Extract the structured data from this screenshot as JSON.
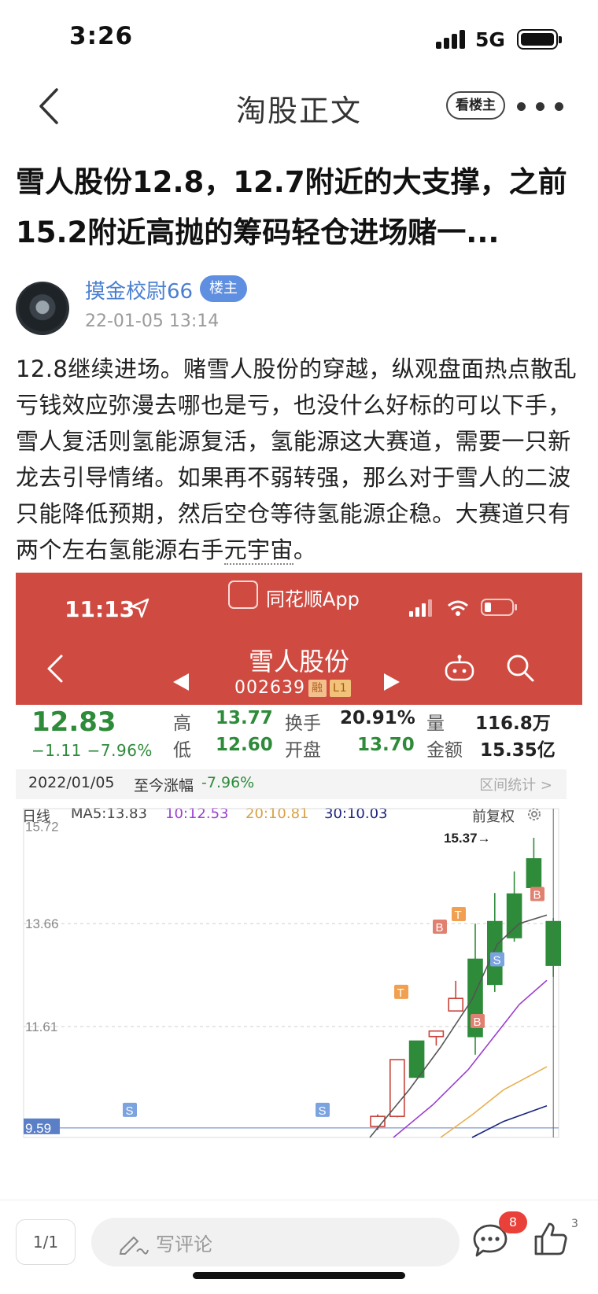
{
  "status_bar": {
    "time": "3:26",
    "network": "5G"
  },
  "nav": {
    "title": "淘股正文",
    "owner_btn": "看楼主"
  },
  "post": {
    "title": "雪人股份12.8，12.7附近的大支撑，之前15.2附近高抛的筹码轻仓进场赌一...",
    "author": "摸金校尉66",
    "owner_badge": "楼主",
    "time": "22-01-05 13:14",
    "body_main": "12.8继续进场。赌雪人股份的穿越，纵观盘面热点散乱亏钱效应弥漫去哪也是亏，也没什么好标的可以下手，雪人复活则氢能源复活，氢能源这大赛道，需要一只新龙去引导情绪。如果再不弱转强，那么对于雪人的二波只能降低预期，然后空仓等待氢能源企稳。大赛道只有两个左右氢能源右手",
    "body_link": "元宇宙",
    "body_end": "。"
  },
  "screenshot": {
    "time": "11:13",
    "app_name": "同花顺App",
    "stock_name": "雪人股份",
    "stock_code": "002639",
    "tag_rong": "融",
    "tag_l1": "L1",
    "price": "12.83",
    "change": "−1.11  −7.96%",
    "quote": {
      "high_label": "高",
      "high": "13.77",
      "low_label": "低",
      "low": "12.60",
      "turnover_label": "换手",
      "turnover": "20.91%",
      "open_label": "开盘",
      "open": "13.70",
      "volume_label": "量",
      "volume": "116.8万",
      "amount_label": "金额",
      "amount": "15.35亿"
    },
    "range": {
      "date": "2022/01/05",
      "label": "至今涨幅",
      "value": "-7.96%",
      "link": "区间统计 >"
    },
    "ma": {
      "period": "日线",
      "ma5": "MA5:13.83",
      "ma10": "10:12.53",
      "ma20": "20:10.81",
      "ma30": "30:10.03",
      "adjust": "前复权"
    },
    "colors": {
      "header": "#cf4b42",
      "down": "#2e8b3a",
      "up": "#c8423a",
      "ma5": "#555555",
      "ma10": "#9b3fd1",
      "ma20": "#e6b050",
      "ma30": "#1a237e"
    }
  },
  "chart_data": {
    "type": "candlestick",
    "ytick_labels": [
      "15.72",
      "13.66",
      "11.61",
      "9.59"
    ],
    "ylim": [
      9.4,
      15.95
    ],
    "annotation": "15.37→",
    "grid": true,
    "candles": [
      {
        "o": 9.62,
        "c": 9.82,
        "h": 9.86,
        "l": 9.55
      },
      {
        "o": 9.82,
        "c": 10.95,
        "h": 10.95,
        "l": 9.8
      },
      {
        "o": 11.32,
        "c": 10.6,
        "h": 11.32,
        "l": 10.6
      },
      {
        "o": 11.41,
        "c": 11.52,
        "h": 11.52,
        "l": 11.23
      },
      {
        "o": 11.92,
        "c": 12.17,
        "h": 12.52,
        "l": 11.92
      },
      {
        "o": 12.95,
        "c": 11.41,
        "h": 13.66,
        "l": 11.05
      },
      {
        "o": 13.7,
        "c": 12.45,
        "h": 14.27,
        "l": 12.3
      },
      {
        "o": 14.25,
        "c": 13.38,
        "h": 14.7,
        "l": 13.3
      },
      {
        "o": 14.95,
        "c": 14.38,
        "h": 15.37,
        "l": 14.32
      },
      {
        "o": 13.7,
        "c": 12.83,
        "h": 13.77,
        "l": 12.6
      }
    ],
    "markers": [
      "S",
      "S",
      "T",
      "B",
      "T",
      "B",
      "S",
      "B"
    ]
  },
  "bottom": {
    "page": "1/1",
    "comment_placeholder": "写评论",
    "comment_count": "8",
    "like_count": "3"
  }
}
